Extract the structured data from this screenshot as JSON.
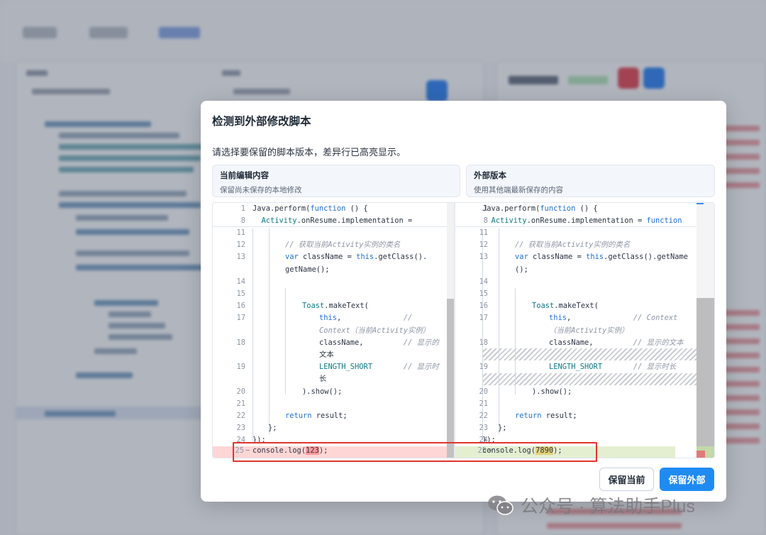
{
  "modal": {
    "title": "检测到外部修改脚本",
    "description": "请选择要保留的脚本版本，差异行已高亮显示。",
    "left_version": {
      "title": "当前编辑内容",
      "subtitle": "保留尚未保存的本地修改"
    },
    "right_version": {
      "title": "外部版本",
      "subtitle": "使用其他端最新保存的内容"
    },
    "buttons": {
      "keep_current": "保留当前",
      "keep_external": "保留外部"
    }
  },
  "diff": {
    "left": {
      "sticky": [
        {
          "ln": "1",
          "code": "Java.perform(function () {"
        },
        {
          "ln": "8",
          "code": "  Activity.onResume.implementation ="
        }
      ],
      "lines": [
        {
          "ln": "11",
          "code": ""
        },
        {
          "ln": "12",
          "code": "// 获取当前Activity实例的类名"
        },
        {
          "ln": "13",
          "code": "var className = this.getClass()."
        },
        {
          "ln": "",
          "code": "getName();"
        },
        {
          "ln": "14",
          "code": ""
        },
        {
          "ln": "15",
          "code": ""
        },
        {
          "ln": "16",
          "code": "Toast.makeText("
        },
        {
          "ln": "17",
          "code": "this,              //"
        },
        {
          "ln": "",
          "code": "Context（当前Activity实例）"
        },
        {
          "ln": "18",
          "code": "className,         // 显示的"
        },
        {
          "ln": "",
          "code": "文本"
        },
        {
          "ln": "19",
          "code": "LENGTH_SHORT       // 显示时"
        },
        {
          "ln": "",
          "code": "长"
        },
        {
          "ln": "20",
          "code": ").show();"
        },
        {
          "ln": "21",
          "code": ""
        },
        {
          "ln": "22",
          "code": "return result;"
        },
        {
          "ln": "23",
          "code": "};"
        },
        {
          "ln": "24",
          "code": "});"
        }
      ],
      "changed": {
        "ln": "25",
        "marker": "−",
        "prefix": "console.log(",
        "value": "123",
        "suffix": ");"
      }
    },
    "right": {
      "sticky": [
        {
          "ln": "1",
          "code": "Java.perform(function () {"
        },
        {
          "ln": "8",
          "code": "  Activity.onResume.implementation = function"
        }
      ],
      "lines": [
        {
          "ln": "11",
          "code": ""
        },
        {
          "ln": "12",
          "code": "// 获取当前Activity实例的类名"
        },
        {
          "ln": "13",
          "code": "var className = this.getClass().getName"
        },
        {
          "ln": "",
          "code": "();"
        },
        {
          "ln": "14",
          "code": ""
        },
        {
          "ln": "15",
          "code": ""
        },
        {
          "ln": "16",
          "code": "Toast.makeText("
        },
        {
          "ln": "17",
          "code": "this,              // Context"
        },
        {
          "ln": "",
          "code": "（当前Activity实例）"
        },
        {
          "ln": "18",
          "code": "className,         // 显示的文本"
        },
        {
          "ln": "",
          "code": ""
        },
        {
          "ln": "19",
          "code": "LENGTH_SHORT       // 显示时长"
        },
        {
          "ln": "",
          "code": ""
        },
        {
          "ln": "20",
          "code": ").show();"
        },
        {
          "ln": "21",
          "code": ""
        },
        {
          "ln": "22",
          "code": "return result;"
        },
        {
          "ln": "23",
          "code": "};"
        },
        {
          "ln": "24",
          "code": "});"
        }
      ],
      "changed": {
        "ln": "25",
        "marker": "+",
        "prefix": "console.log(",
        "value": "7890",
        "suffix": ");"
      }
    }
  },
  "watermark": "公众号 · 算法助手Plus",
  "colors": {
    "primary": "#1f8bf2",
    "deleted": "#ffd6d6",
    "added": "#e4efd1",
    "highlight_box": "#e3342f"
  }
}
